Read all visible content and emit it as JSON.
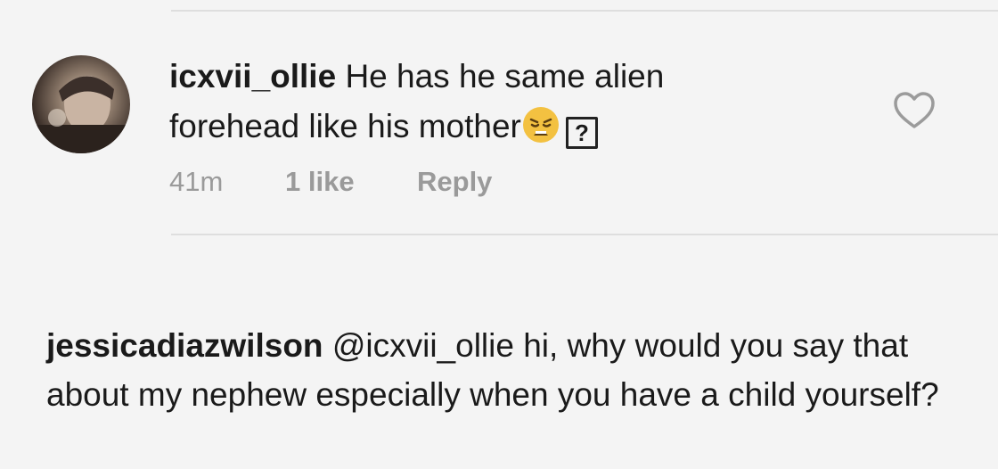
{
  "comment": {
    "username": "icxvii_ollie",
    "text_line1": "He has he same alien",
    "text_line2": "forehead like his mother",
    "emoji": "weary-face-emoji",
    "missing_glyph": "?",
    "time": "41m",
    "likes": "1 like",
    "reply_label": "Reply",
    "like_icon": "heart-outline-icon"
  },
  "reply_comment": {
    "username": "jessicadiazwilson",
    "text": "@icxvii_ollie hi, why would you say that about my nephew especially when you have a child yourself?"
  }
}
